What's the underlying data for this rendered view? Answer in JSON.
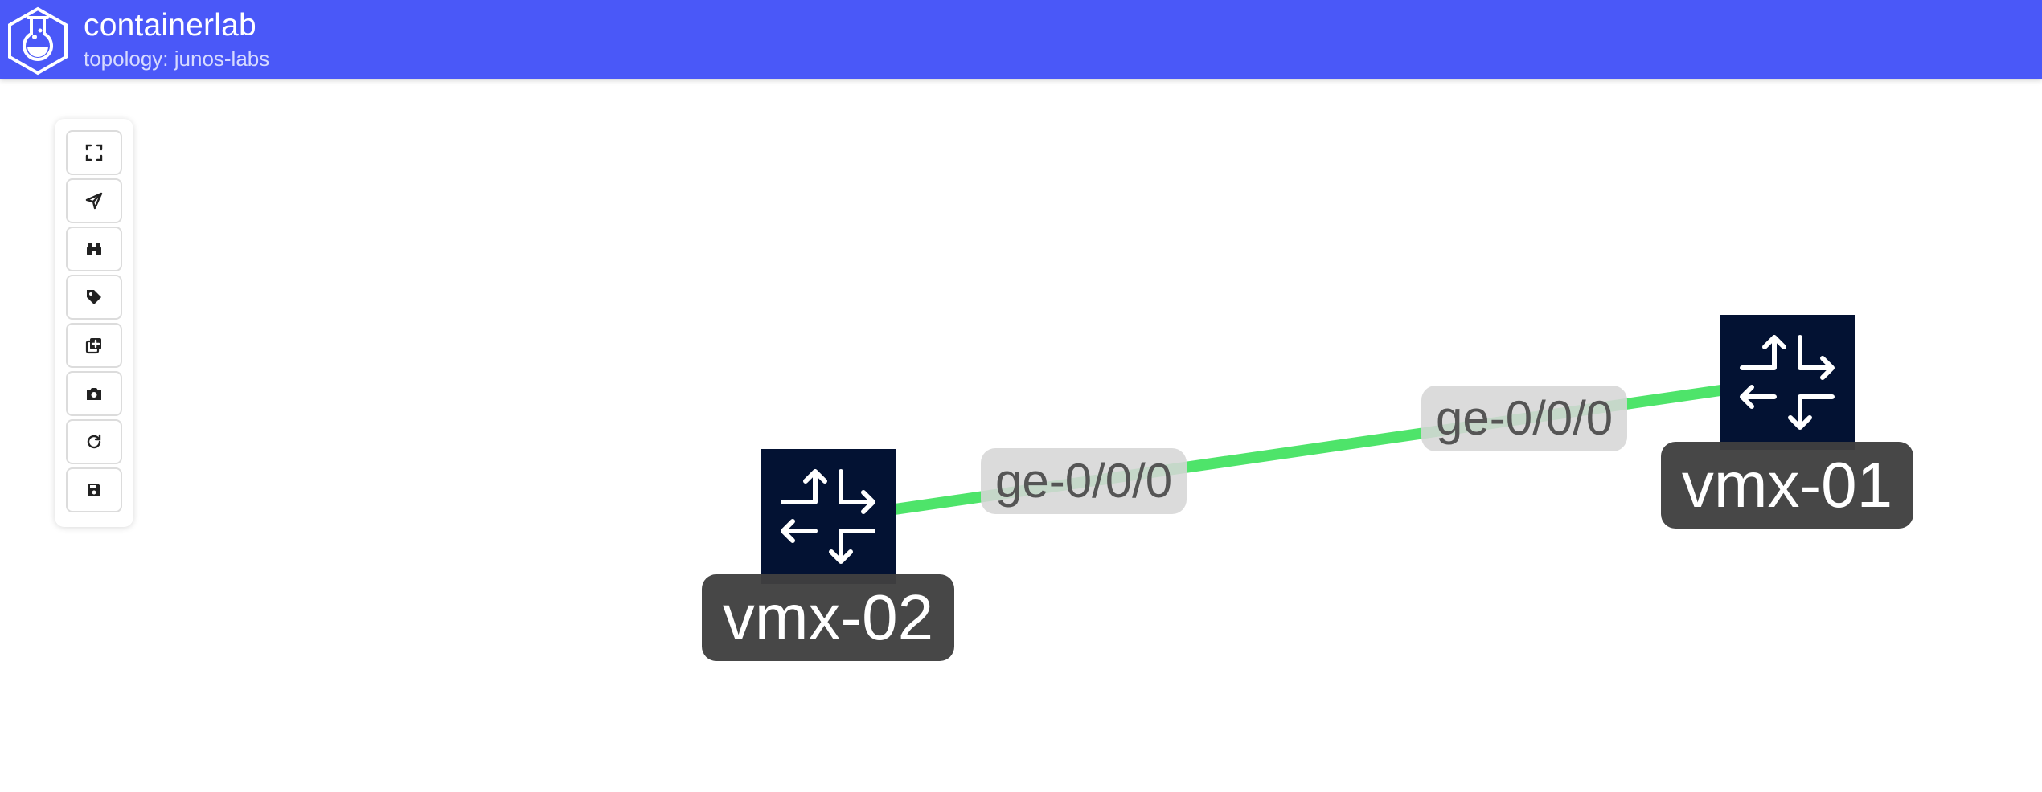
{
  "header": {
    "app_title": "containerlab",
    "topology_line": "topology: junos-labs"
  },
  "toolbar": {
    "buttons": [
      {
        "name": "fit-view-button",
        "icon": "expand-icon"
      },
      {
        "name": "layout-button",
        "icon": "paper-plane-icon"
      },
      {
        "name": "find-node-button",
        "icon": "binoculars-icon"
      },
      {
        "name": "labels-button",
        "icon": "tag-icon"
      },
      {
        "name": "add-node-button",
        "icon": "plus-square-icon"
      },
      {
        "name": "capture-button",
        "icon": "camera-icon"
      },
      {
        "name": "reload-button",
        "icon": "refresh-icon"
      },
      {
        "name": "save-button",
        "icon": "save-icon"
      }
    ]
  },
  "topology": {
    "nodes": [
      {
        "id": "vmx-02",
        "label": "vmx-02",
        "icon": "router-icon"
      },
      {
        "id": "vmx-01",
        "label": "vmx-01",
        "icon": "router-icon"
      }
    ],
    "links": [
      {
        "source": "vmx-02",
        "target": "vmx-01",
        "source_endpoint": "ge-0/0/0",
        "target_endpoint": "ge-0/0/0",
        "color": "#4ee46a"
      }
    ]
  },
  "colors": {
    "header_bg": "#4a58f8",
    "node_bg": "#031233",
    "link": "#4ee46a",
    "node_label_bg": "#404040",
    "endpoint_label_bg": "#d6d6d6"
  }
}
